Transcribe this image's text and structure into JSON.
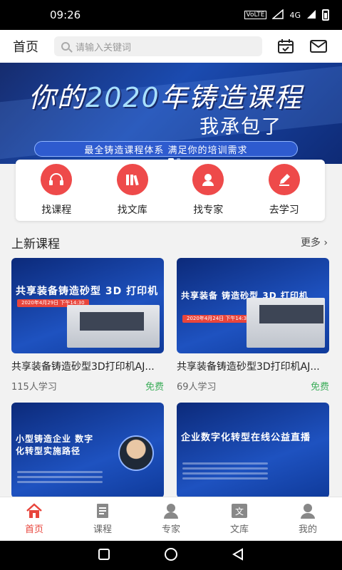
{
  "status_bar": {
    "time": "09:26",
    "network": "VoLTE",
    "signal_label": "4G"
  },
  "header": {
    "title": "首页",
    "search_placeholder": "请输入关键词"
  },
  "banner": {
    "headline_a": "你的",
    "headline_b": "2020",
    "headline_c": "年铸造课程",
    "subline": "我承包了",
    "tagline": "最全铸造课程体系  满足你的培训需求"
  },
  "quick_links": [
    {
      "label": "找课程",
      "icon": "headphones-icon"
    },
    {
      "label": "找文库",
      "icon": "books-icon"
    },
    {
      "label": "找专家",
      "icon": "person-icon"
    },
    {
      "label": "去学习",
      "icon": "pencil-icon"
    }
  ],
  "section": {
    "title": "上新课程",
    "more": "更多 ›"
  },
  "courses": [
    {
      "title": "共享装备铸造砂型3D打印机AJ...",
      "learners": "115人学习",
      "price": "免费",
      "thumb_text": "共享装备铸造砂型 3D 打印机",
      "thumb_date": "2020年4月29日 下午14:30"
    },
    {
      "title": "共享装备铸造砂型3D打印机AJ...",
      "learners": "69人学习",
      "price": "免费",
      "thumb_text": "共享装备 铸造砂型 3D 打印机",
      "thumb_date": "2020年4月24日 下午14:30"
    },
    {
      "title": "",
      "learners": "",
      "price": "",
      "thumb_text": "小型铸造企业 数字化转型实施路径",
      "thumb_date": ""
    },
    {
      "title": "",
      "learners": "",
      "price": "",
      "thumb_text": "企业数字化转型在线公益直播",
      "thumb_date": ""
    }
  ],
  "tabs": [
    {
      "label": "首页",
      "icon": "home-icon",
      "active": true
    },
    {
      "label": "课程",
      "icon": "document-icon",
      "active": false
    },
    {
      "label": "专家",
      "icon": "expert-icon",
      "active": false
    },
    {
      "label": "文库",
      "icon": "library-icon",
      "active": false
    },
    {
      "label": "我的",
      "icon": "profile-icon",
      "active": false
    }
  ],
  "colors": {
    "accent": "#e8453c",
    "free": "#3fae5c",
    "banner": "#1b4bb0"
  }
}
